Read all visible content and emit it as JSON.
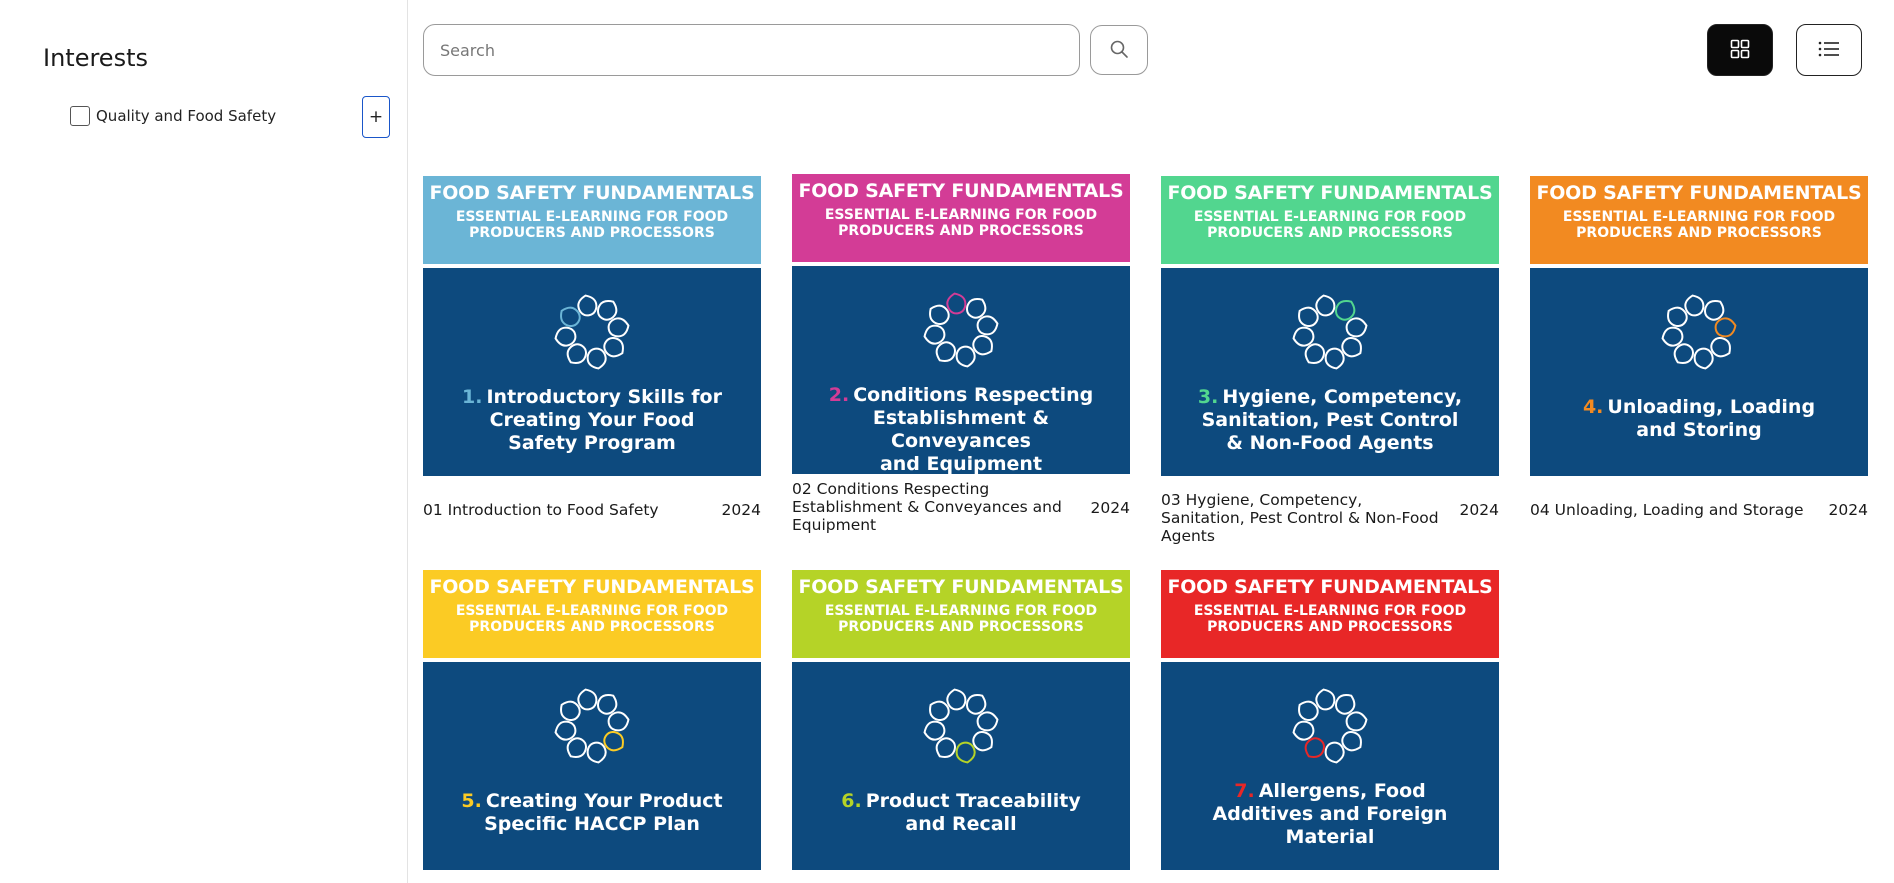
{
  "sidebar": {
    "title": "Interests",
    "interests": [
      {
        "label": "Quality and Food Safety",
        "checked": false,
        "expand_label": "+"
      }
    ]
  },
  "search": {
    "placeholder": "Search",
    "value": ""
  },
  "icons": {
    "search": "search-icon",
    "grid_view": "grid-view-icon",
    "list_view": "list-view-icon"
  },
  "banner": {
    "title": "FOOD SAFETY FUNDAMENTALS",
    "subtitle_line1": "ESSENTIAL E-LEARNING FOR FOOD",
    "subtitle_line2": "PRODUCERS AND PROCESSORS"
  },
  "colors": {
    "body_blue": "#0d4a7e"
  },
  "courses": [
    {
      "num": "1.",
      "title_lines": [
        "Introductory Skills for",
        "Creating Your Food",
        "Safety Program"
      ],
      "name": "01 Introduction to Food Safety",
      "year": "2024",
      "color": "#6bb5d6"
    },
    {
      "num": "2.",
      "title_lines": [
        "Conditions Respecting",
        "Establishment & Conveyances",
        "and Equipment"
      ],
      "name": "02 Conditions Respecting Establishment & Conveyances and Equipment",
      "year": "2024",
      "color": "#d33c96"
    },
    {
      "num": "3.",
      "title_lines": [
        "Hygiene, Competency,",
        "Sanitation, Pest Control",
        "& Non-Food Agents"
      ],
      "name": "03 Hygiene, Competency, Sanitation, Pest Control & Non-Food Agents",
      "year": "2024",
      "color": "#52d68f"
    },
    {
      "num": "4.",
      "title_lines": [
        "Unloading, Loading",
        "and Storing"
      ],
      "name": "04 Unloading, Loading and Storage",
      "year": "2024",
      "color": "#f28a21"
    },
    {
      "num": "5.",
      "title_lines": [
        "Creating Your Product",
        "Specific HACCP Plan"
      ],
      "name": "",
      "year": "",
      "color": "#fbcb24"
    },
    {
      "num": "6.",
      "title_lines": [
        "Product Traceability",
        "and Recall"
      ],
      "name": "",
      "year": "",
      "color": "#b5d327"
    },
    {
      "num": "7.",
      "title_lines": [
        "Allergens, Food",
        "Additives and Foreign",
        "Material"
      ],
      "name": "",
      "year": "",
      "color": "#e82727"
    }
  ]
}
